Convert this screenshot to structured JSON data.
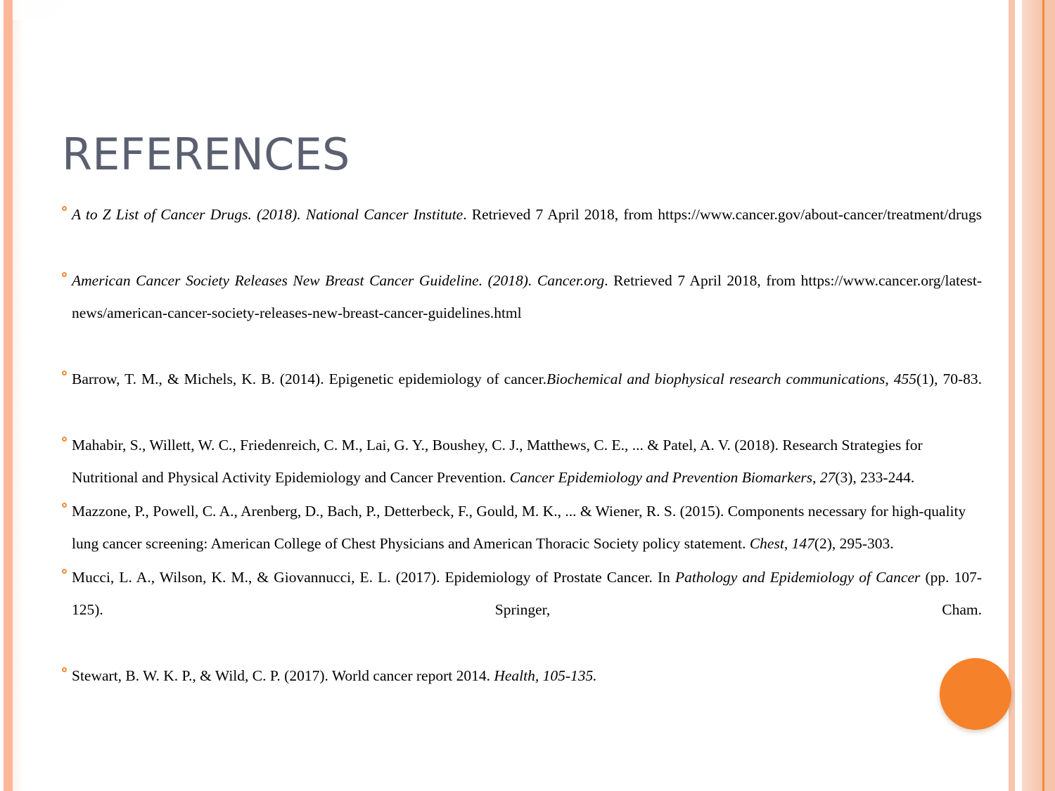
{
  "slide": {
    "title": "REFERENCES",
    "title_color": "#5b6070",
    "accent_color": "#f5822a",
    "bullet_color": "#f08b3c",
    "frame_color": "#fcb79a",
    "background": "#ffffff"
  },
  "references": [
    {
      "id": "ref-a-to-z-list",
      "justified": true,
      "bullet": "orange-ring-bullet",
      "segments": [
        {
          "text": "A to Z List of Cancer Drugs. (2018). National Cancer Institute",
          "style": "italic"
        },
        {
          "text": ". Retrieved 7 April 2018, from https://www.cancer.gov/about-cancer/treatment/drugs",
          "style": "normal"
        }
      ]
    },
    {
      "id": "ref-acs-breast-guideline",
      "justified": true,
      "bullet": "orange-ring-bullet",
      "segments": [
        {
          "text": "American Cancer Society Releases New Breast Cancer Guideline. (2018). Cancer.org",
          "style": "italic"
        },
        {
          "text": ". Retrieved 7 April 2018, from https://www.cancer.org/latest-news/american-cancer-society-releases-new-breast-cancer-guidelines.html",
          "style": "normal"
        }
      ]
    },
    {
      "id": "ref-barrow-michels",
      "justified": true,
      "bullet": "orange-ring-bullet",
      "segments": [
        {
          "text": "Barrow, T. M., & Michels, K. B. (2014). Epigenetic epidemiology of cancer.",
          "style": "normal"
        },
        {
          "text": "Biochemical and biophysical research communications",
          "style": "italic"
        },
        {
          "text": ", ",
          "style": "normal"
        },
        {
          "text": "455",
          "style": "italic"
        },
        {
          "text": "(1), 70-83.",
          "style": "normal"
        }
      ]
    },
    {
      "id": "ref-mahabir",
      "justified": false,
      "bullet": "orange-ring-bullet",
      "segments": [
        {
          "text": "Mahabir, S., Willett, W. C., Friedenreich, C. M., Lai, G. Y., Boushey, C. J., Matthews, C. E., ... & Patel, A. V. (2018). Research Strategies for Nutritional and Physical Activity Epidemiology and Cancer Prevention. ",
          "style": "normal"
        },
        {
          "text": "Cancer Epidemiology and Prevention Biomarkers",
          "style": "italic"
        },
        {
          "text": ", ",
          "style": "normal"
        },
        {
          "text": "27",
          "style": "italic"
        },
        {
          "text": "(3), 233-244.",
          "style": "normal"
        }
      ]
    },
    {
      "id": "ref-mazzone",
      "justified": false,
      "bullet": "orange-ring-bullet",
      "segments": [
        {
          "text": "Mazzone, P., Powell, C. A., Arenberg, D., Bach, P., Detterbeck, F., Gould, M. K., ... & Wiener, R. S. (2015). Components necessary for high-quality lung cancer screening: American College of Chest Physicians and American Thoracic Society policy statement. ",
          "style": "normal"
        },
        {
          "text": "Chest",
          "style": "italic"
        },
        {
          "text": ", ",
          "style": "normal"
        },
        {
          "text": "147",
          "style": "italic"
        },
        {
          "text": "(2), 295-303.",
          "style": "normal"
        }
      ]
    },
    {
      "id": "ref-mucci",
      "justified": true,
      "bullet": "orange-ring-bullet",
      "segments": [
        {
          "text": "Mucci, L. A., Wilson, K. M., & Giovannucci, E. L. (2017). Epidemiology of Prostate Cancer. In ",
          "style": "normal"
        },
        {
          "text": "Pathology and Epidemiology of Cancer",
          "style": "italic"
        },
        {
          "text": " (pp. 107-125). Springer, Cham.",
          "style": "normal"
        }
      ]
    },
    {
      "id": "ref-stewart-wild",
      "justified": false,
      "bullet": "orange-ring-bullet",
      "segments": [
        {
          "text": "Stewart, B. W. K. P., & Wild, C. P. (2017). World cancer report 2014. ",
          "style": "normal"
        },
        {
          "text": "Health, 105-135.",
          "style": "italic"
        }
      ]
    }
  ]
}
